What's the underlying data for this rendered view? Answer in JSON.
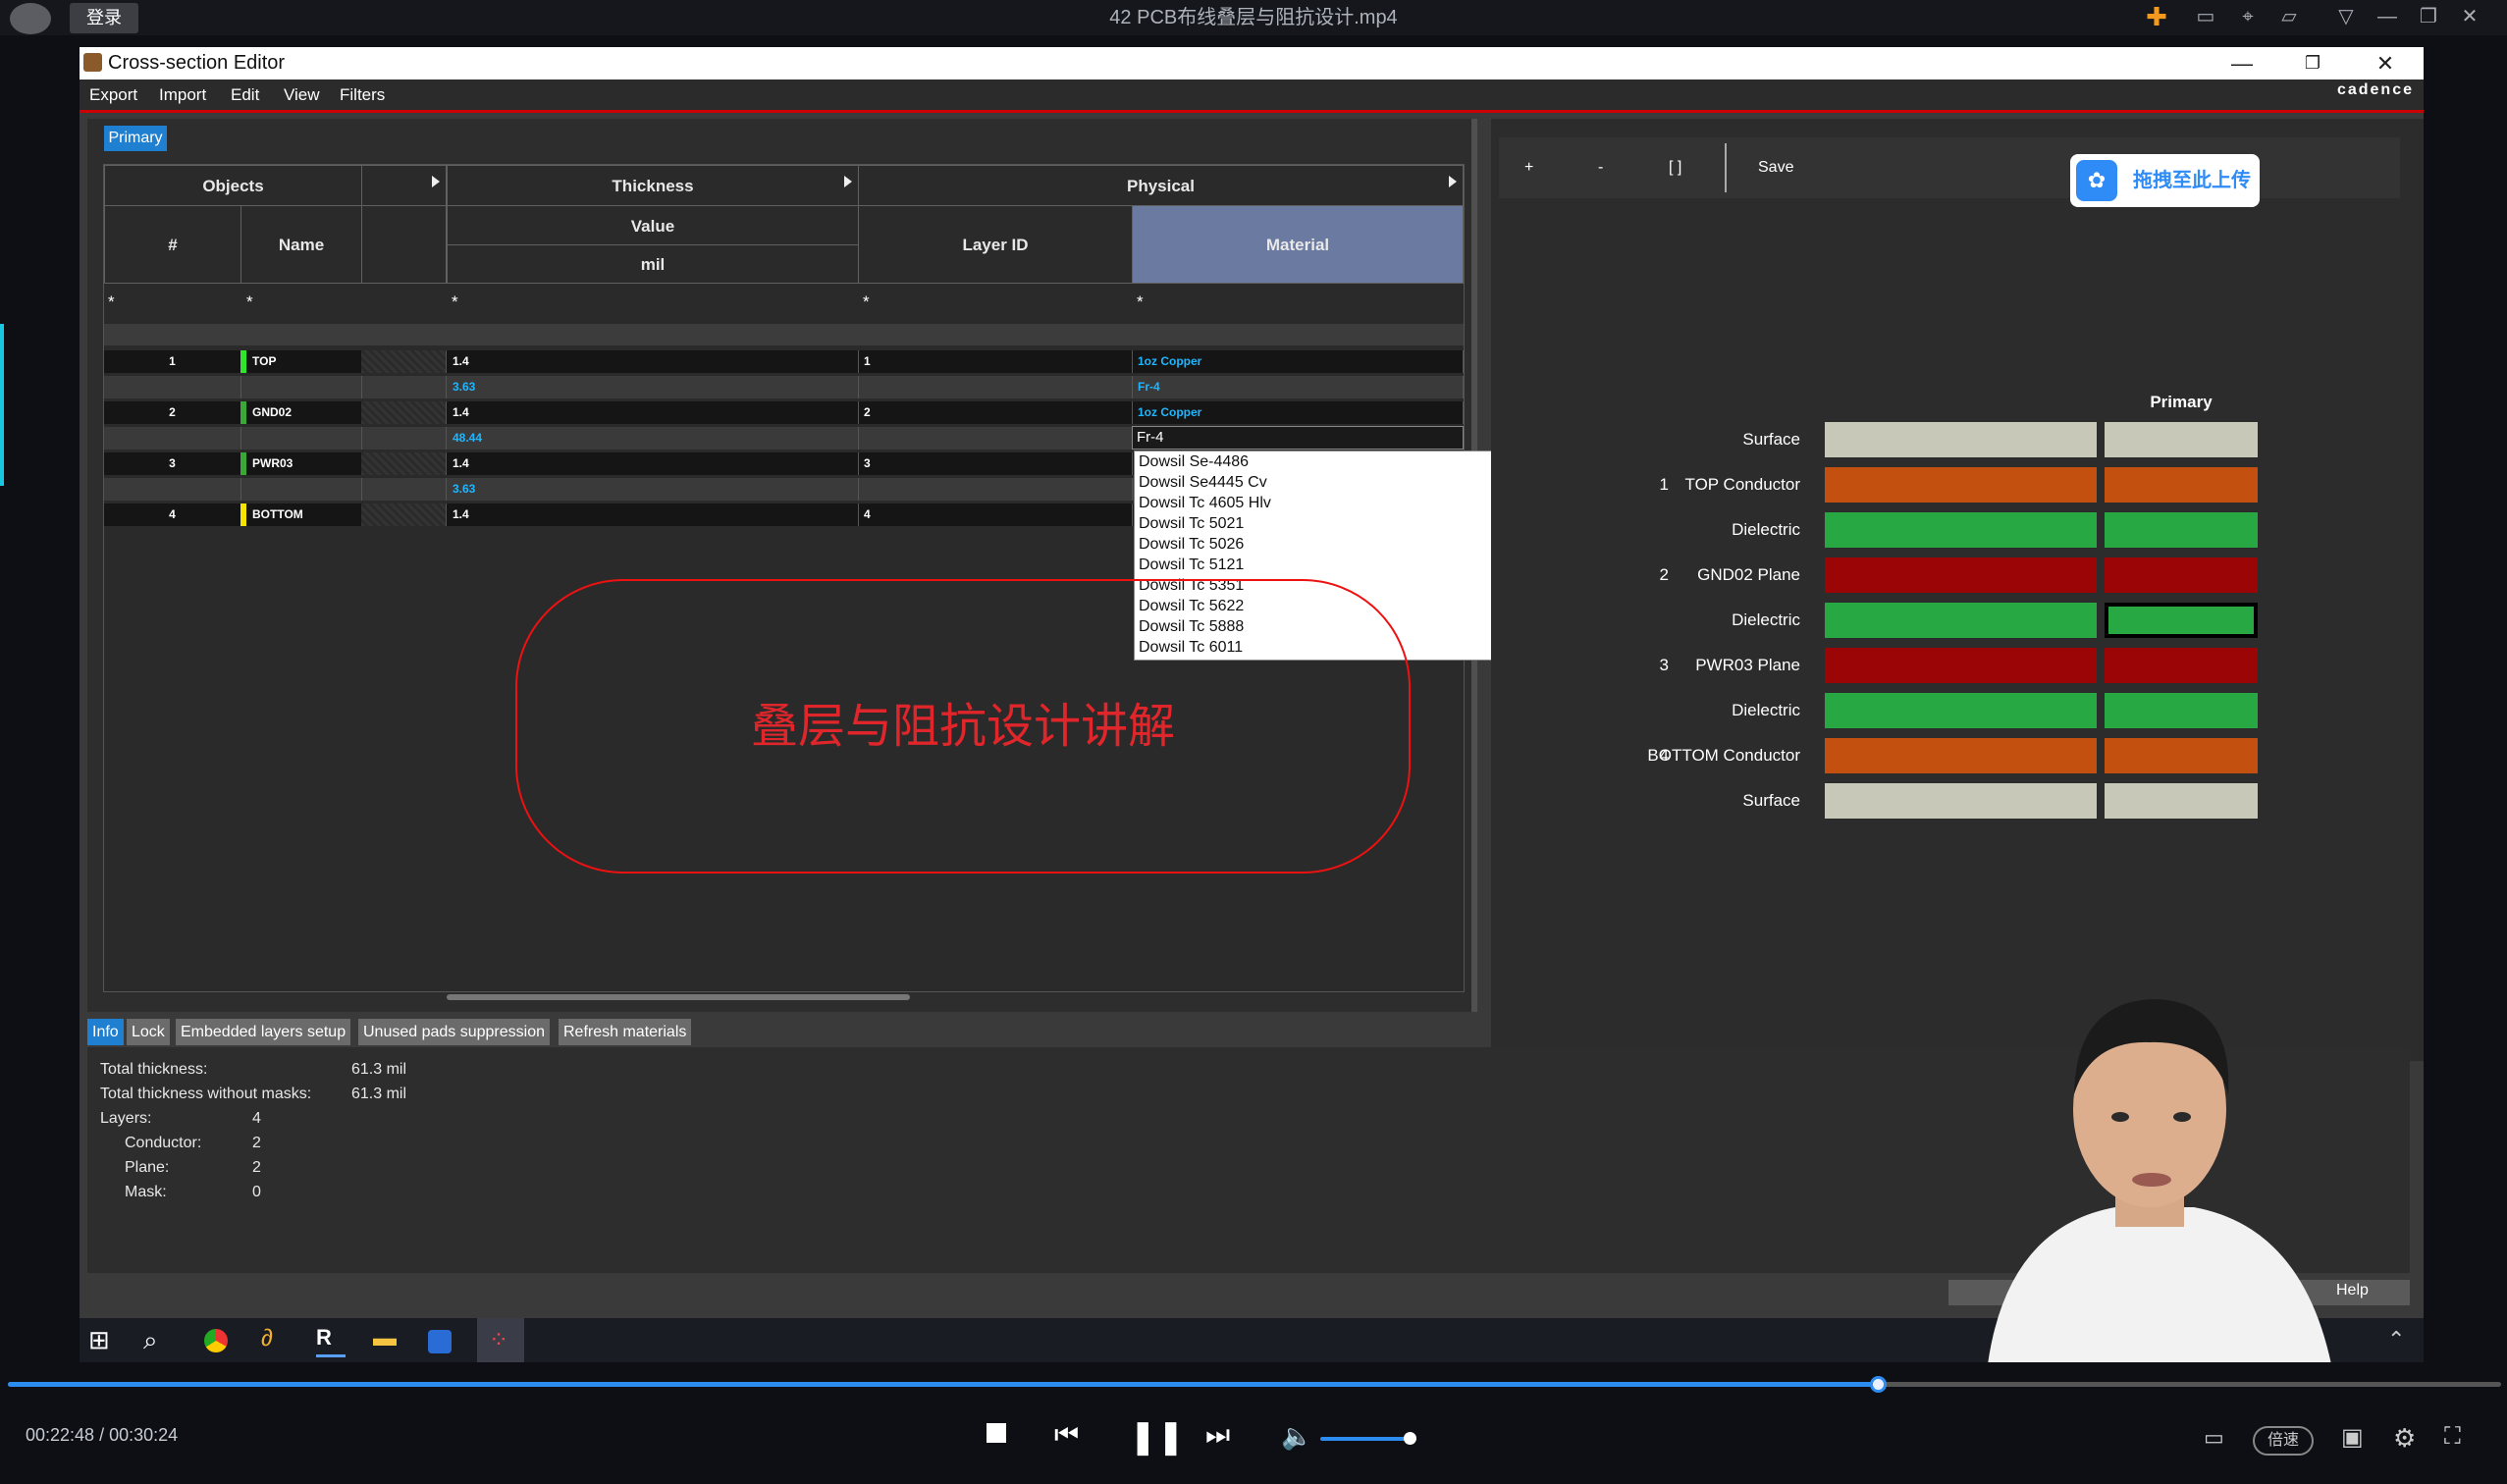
{
  "player": {
    "login_label": "登录",
    "video_title": "42 PCB布线叠层与阻抗设计.mp4",
    "time_current": "00:22:48",
    "time_separator": "/",
    "time_total": "00:30:24",
    "speed_label": "倍速",
    "progress_fraction": 0.75,
    "volume_fraction": 0.95,
    "accent_color": "#2d8cf0"
  },
  "window": {
    "title": "Cross-section Editor",
    "brand": "cadence",
    "menu": [
      "Export",
      "Import",
      "Edit",
      "View",
      "Filters"
    ]
  },
  "table": {
    "tab": "Primary",
    "groups": {
      "objects": "Objects",
      "thickness": "Thickness",
      "physical": "Physical"
    },
    "columns": {
      "num": "#",
      "name": "Name",
      "value": "Value",
      "unit": "mil",
      "layer_id": "Layer ID",
      "material": "Material"
    },
    "filter": "*",
    "rows": [
      {
        "num": "1",
        "name": "TOP",
        "thickness": "1.4",
        "layer_id": "1",
        "material": "1oz Copper",
        "color": "#2ee62e"
      },
      {
        "thickness": "3.63",
        "material": "Fr-4"
      },
      {
        "num": "2",
        "name": "GND02",
        "thickness": "1.4",
        "layer_id": "2",
        "material": "1oz Copper",
        "color": "#3aa835"
      },
      {
        "thickness": "48.44",
        "material": "Fr-4"
      },
      {
        "num": "3",
        "name": "PWR03",
        "thickness": "1.4",
        "layer_id": "3",
        "material": "",
        "color": "#3aa835"
      },
      {
        "thickness": "3.63",
        "material": ""
      },
      {
        "num": "4",
        "name": "BOTTOM",
        "thickness": "1.4",
        "layer_id": "4",
        "material": "",
        "color": "#f5e400"
      }
    ]
  },
  "dropdown": {
    "options": [
      "Dowsil Se-4486",
      "Dowsil Se4445 Cv",
      "Dowsil Tc 4605 Hlv",
      "Dowsil Tc 5021",
      "Dowsil Tc 5026",
      "Dowsil Tc 5121",
      "Dowsil Tc 5351",
      "Dowsil Tc 5622",
      "Dowsil Tc 5888",
      "Dowsil Tc 6011"
    ]
  },
  "overlay_text": "叠层与阻抗设计讲解",
  "right_panel": {
    "toolbar": {
      "add": "+",
      "remove": "-",
      "brackets": "[ ]",
      "save": "Save"
    },
    "upload_label": "拖拽至此上传",
    "column_title": "Primary",
    "stack": [
      {
        "num": "",
        "label": "Surface",
        "color": "#c8c8b8"
      },
      {
        "num": "1",
        "label": "TOP Conductor",
        "color": "#c4500f"
      },
      {
        "num": "",
        "label": "Dielectric",
        "color": "#27a843"
      },
      {
        "num": "2",
        "label": "GND02 Plane",
        "color": "#9b0505"
      },
      {
        "num": "",
        "label": "Dielectric",
        "color": "#27a843"
      },
      {
        "num": "3",
        "label": "PWR03 Plane",
        "color": "#9b0505"
      },
      {
        "num": "",
        "label": "Dielectric",
        "color": "#27a843"
      },
      {
        "num": "4",
        "label": "BOTTOM Conductor",
        "color": "#c4500f"
      },
      {
        "num": "",
        "label": "Surface",
        "color": "#c8c8b8"
      }
    ]
  },
  "bottom_tabs": [
    "Info",
    "Lock",
    "Embedded layers setup",
    "Unused pads suppression",
    "Refresh materials"
  ],
  "info": {
    "total_thickness_label": "Total thickness:",
    "total_thickness": "61.3 mil",
    "total_wo_masks_label": "Total thickness without masks:",
    "total_wo_masks": "61.3 mil",
    "layers_label": "Layers:",
    "layers": "4",
    "conductor_label": "Conductor:",
    "conductor": "2",
    "plane_label": "Plane:",
    "plane": "2",
    "mask_label": "Mask:",
    "mask": "0"
  },
  "help_label": "Help"
}
